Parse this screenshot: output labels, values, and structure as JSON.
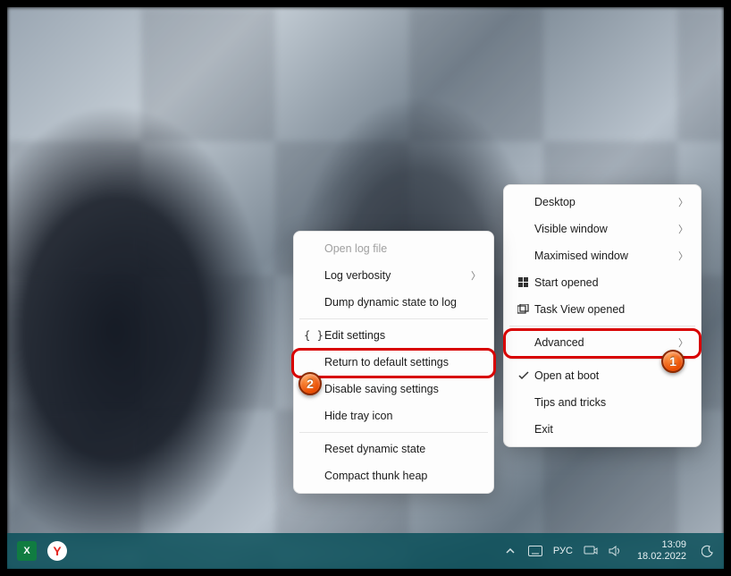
{
  "menu_left": {
    "items": [
      {
        "label": "Open log file",
        "disabled": true
      },
      {
        "label": "Log verbosity",
        "submenu": true
      },
      {
        "label": "Dump dynamic state to log"
      },
      {
        "sep": true
      },
      {
        "label": "Edit settings",
        "icon": "braces"
      },
      {
        "label": "Return to default settings",
        "highlight": 2
      },
      {
        "label": "Disable saving settings"
      },
      {
        "label": "Hide tray icon"
      },
      {
        "sep": true
      },
      {
        "label": "Reset dynamic state"
      },
      {
        "label": "Compact thunk heap"
      }
    ]
  },
  "menu_right": {
    "items": [
      {
        "label": "Desktop",
        "submenu": true
      },
      {
        "label": "Visible window",
        "submenu": true
      },
      {
        "label": "Maximised window",
        "submenu": true
      },
      {
        "label": "Start opened",
        "icon": "windows"
      },
      {
        "label": "Task View opened",
        "icon": "taskview"
      },
      {
        "sep": true
      },
      {
        "label": "Advanced",
        "submenu": true,
        "highlight": 1
      },
      {
        "sep": true
      },
      {
        "label": "Open at boot",
        "icon": "check"
      },
      {
        "label": "Tips and tricks"
      },
      {
        "label": "Exit"
      }
    ]
  },
  "taskbar": {
    "apps": {
      "excel": "X",
      "yandex": "Y"
    },
    "lang": "РУС",
    "time": "13:09",
    "date": "18.02.2022"
  },
  "annotations": {
    "badge1": "1",
    "badge2": "2"
  }
}
